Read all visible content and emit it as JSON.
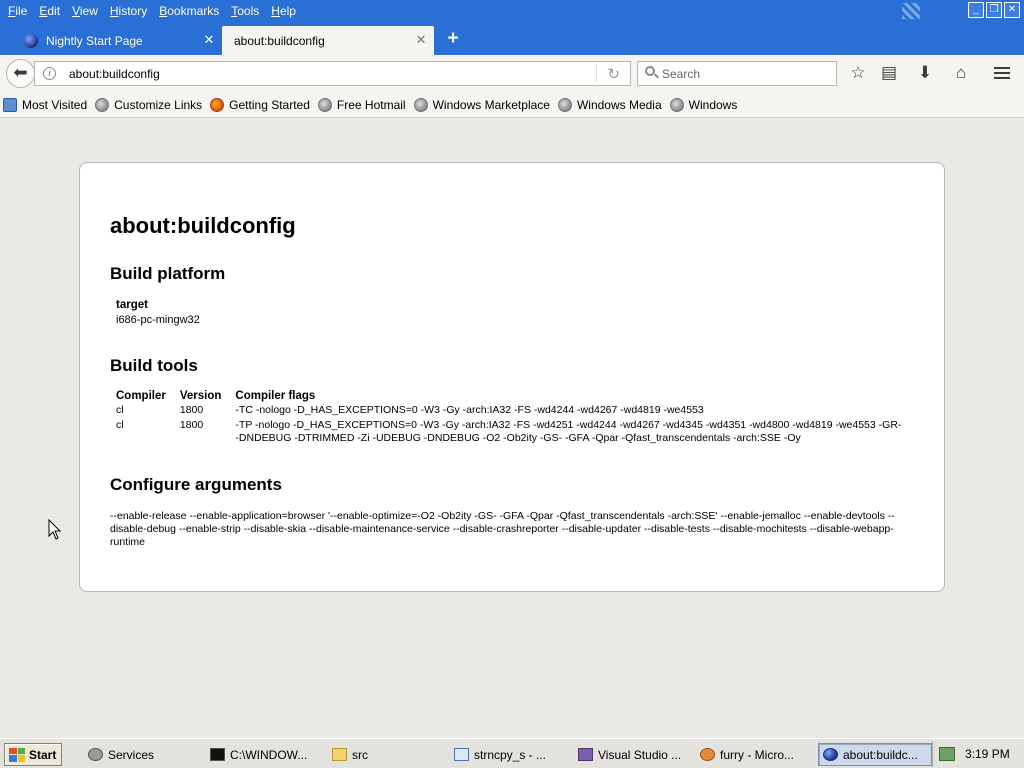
{
  "menu": [
    "File",
    "Edit",
    "View",
    "History",
    "Bookmarks",
    "Tools",
    "Help"
  ],
  "menu_access_keys": [
    "F",
    "E",
    "V",
    "H",
    "B",
    "T",
    "H"
  ],
  "tabs": [
    {
      "label": "Nightly Start Page",
      "active": false
    },
    {
      "label": "about:buildconfig",
      "active": true
    }
  ],
  "nav": {
    "url": "about:buildconfig",
    "search_placeholder": "Search"
  },
  "bookmarks": [
    {
      "label": "Most Visited",
      "icon": "folder-icon"
    },
    {
      "label": "Customize Links",
      "icon": "globe-icon"
    },
    {
      "label": "Getting Started",
      "icon": "firefox-icon"
    },
    {
      "label": "Free Hotmail",
      "icon": "globe-icon"
    },
    {
      "label": "Windows Marketplace",
      "icon": "globe-icon"
    },
    {
      "label": "Windows Media",
      "icon": "globe-icon"
    },
    {
      "label": "Windows",
      "icon": "globe-icon"
    }
  ],
  "page": {
    "title": "about:buildconfig",
    "platform_heading": "Build platform",
    "platform_label": "target",
    "platform_value": "i686-pc-mingw32",
    "tools_heading": "Build tools",
    "tools_columns": [
      "Compiler",
      "Version",
      "Compiler flags"
    ],
    "tools_rows": [
      {
        "compiler": "cl",
        "version": "1800",
        "flags": "-TC -nologo -D_HAS_EXCEPTIONS=0 -W3 -Gy -arch:IA32 -FS -wd4244 -wd4267 -wd4819 -we4553"
      },
      {
        "compiler": "cl",
        "version": "1800",
        "flags": "-TP -nologo -D_HAS_EXCEPTIONS=0 -W3 -Gy -arch:IA32 -FS -wd4251 -wd4244 -wd4267 -wd4345 -wd4351 -wd4800 -wd4819 -we4553 -GR- -DNDEBUG -DTRIMMED -Zi -UDEBUG -DNDEBUG -O2 -Ob2ity -GS- -GFA -Qpar -Qfast_transcendentals -arch:SSE -Oy"
      }
    ],
    "config_heading": "Configure arguments",
    "config_text": "--enable-release --enable-application=browser '--enable-optimize=-O2 -Ob2ity -GS- -GFA -Qpar -Qfast_transcendentals -arch:SSE' --enable-jemalloc --enable-devtools --disable-debug --enable-strip --disable-skia --disable-maintenance-service --disable-crashreporter --disable-updater --disable-tests --disable-mochitests --disable-webapp-runtime"
  },
  "taskbar": {
    "start_label": "Start",
    "tasks": [
      {
        "label": "Services",
        "icon": "gears-icon",
        "active": false
      },
      {
        "label": "C:\\WINDOW...",
        "icon": "console-icon",
        "active": false
      },
      {
        "label": "src",
        "icon": "folder-icon",
        "active": false
      },
      {
        "label": "strncpy_s - ...",
        "icon": "document-icon",
        "active": false
      },
      {
        "label": "Visual Studio ...",
        "icon": "visual-studio-icon",
        "active": false
      },
      {
        "label": "furry - Micro...",
        "icon": "paint-icon",
        "active": false
      },
      {
        "label": "about:buildc...",
        "icon": "nightly-icon",
        "active": true
      }
    ],
    "clock": "3:19 PM"
  }
}
